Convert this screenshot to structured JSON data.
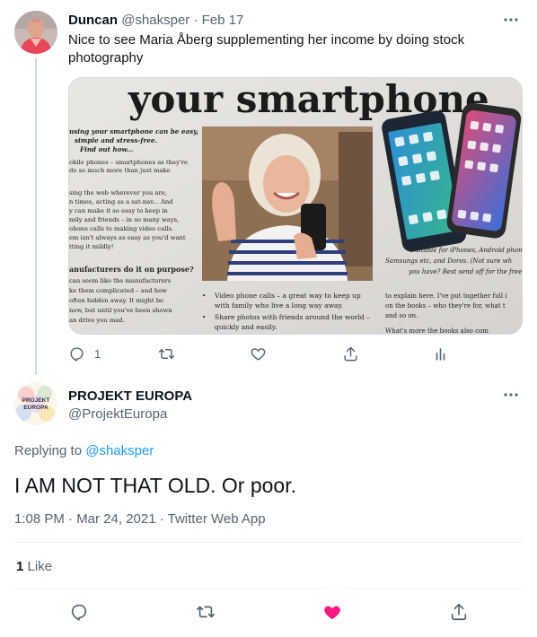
{
  "parent_tweet": {
    "author_name": "Duncan",
    "author_handle": "@shaksper",
    "separator": "·",
    "date": "Feb 17",
    "text": "Nice to see Maria Åberg supplementing her income by doing stock photography",
    "media": {
      "headline": "your smartphone",
      "left_column": {
        "intro_lines": [
          "using your smartphone can be easy,",
          "simple and stress-free.",
          "Find out how..."
        ],
        "body_lines": [
          "obile phones – smartphones as they're",
          "do so much more than just make",
          "",
          "sing the web wherever you are,",
          "n times, acting as a sat-nav... And",
          "y can make it so easy to keep in",
          "mily and friends – in so many ways,",
          "ohone calls to making video calls.",
          "em isn't always as easy as you'd want",
          "tting it mildly!"
        ],
        "subhead": "anufacturers do it on purpose?",
        "sub_lines": [
          "can seem like the manufacturers",
          "ke them complicated – and how",
          "often hidden away. It might be",
          "now, but until you've been shown",
          "an drive you mad."
        ]
      },
      "center_bullets": [
        "Video phone calls – a great way to keep up",
        "with family who live a long way away.",
        "Share photos with friends around the world –",
        "quickly and easily."
      ],
      "right_caption": [
        "Suitable for iPhones, Android phone",
        "Samsungs etc, and Doros.  (Not sure wh",
        "you have?  Best send off for the free t"
      ],
      "right_body": [
        "to explain here.  I've put together full i",
        "on the books – who they're for, what t",
        "and so on.",
        "What's more the books also com"
      ]
    },
    "actions": {
      "reply_count": "1",
      "retweet_count": "",
      "like_count": ""
    }
  },
  "main_tweet": {
    "author_name": "PROJEKT EUROPA",
    "author_handle": "@ProjektEuropa",
    "avatar_text_line1": "PROJEKT",
    "avatar_text_line2": "EUROPA",
    "replying_prefix": "Replying to",
    "replying_to": "@shaksper",
    "text": "I AM NOT THAT OLD. Or poor.",
    "timestamp": "1:08 PM · Mar 24, 2021 · Twitter Web App",
    "like_count": "1",
    "like_label": "Like"
  },
  "icons": {
    "reply": "reply-icon",
    "retweet": "retweet-icon",
    "like": "heart-icon",
    "share": "share-icon",
    "analytics": "analytics-icon",
    "more": "more-icon"
  },
  "colors": {
    "accent": "#1d9bf0",
    "like_active": "#f91880",
    "secondary_text": "#536471",
    "divider": "#eff3f4"
  }
}
